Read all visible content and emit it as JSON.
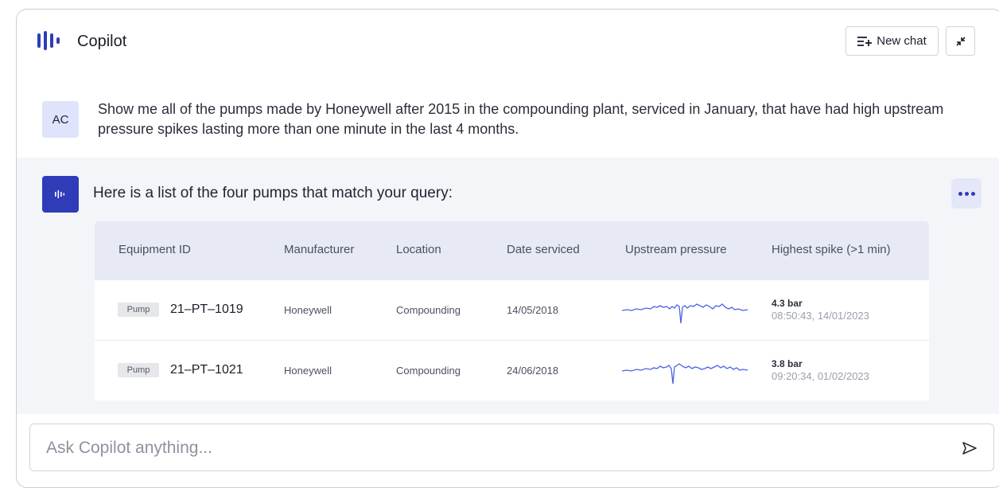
{
  "header": {
    "title": "Copilot",
    "new_chat_label": "New chat"
  },
  "user_message": {
    "initials": "AC",
    "text": "Show me all of the pumps made by Honeywell after 2015 in the compounding plant, serviced in January, that have had high upstream pressure spikes lasting more than one minute in the last 4 months."
  },
  "assistant_message": {
    "text": "Here is a list of the four pumps that match your query:"
  },
  "table": {
    "columns": [
      "Equipment ID",
      "Manufacturer",
      "Location",
      "Date serviced",
      "Upstream pressure",
      "Highest spike (>1 min)"
    ],
    "rows": [
      {
        "type": "Pump",
        "equipment_id": "21–PT–1019",
        "manufacturer": "Honeywell",
        "location": "Compounding",
        "date_serviced": "14/05/2018",
        "spike_value": "4.3 bar",
        "spike_time": "08:50:43, 14/01/2023"
      },
      {
        "type": "Pump",
        "equipment_id": "21–PT–1021",
        "manufacturer": "Honeywell",
        "location": "Compounding",
        "date_serviced": "24/06/2018",
        "spike_value": "3.8 bar",
        "spike_time": "09:20:34, 01/02/2023"
      }
    ]
  },
  "input": {
    "placeholder": "Ask Copilot anything..."
  },
  "colors": {
    "accent": "#2e3cb8",
    "sparkline": "#4a63e6",
    "assistant_bg": "#f4f5f9",
    "table_header_bg": "#e7e9f4"
  },
  "icons": [
    "copilot-logo-icon",
    "new-chat-icon",
    "minimize-icon",
    "copilot-avatar-icon",
    "more-dots-icon",
    "send-icon"
  ]
}
